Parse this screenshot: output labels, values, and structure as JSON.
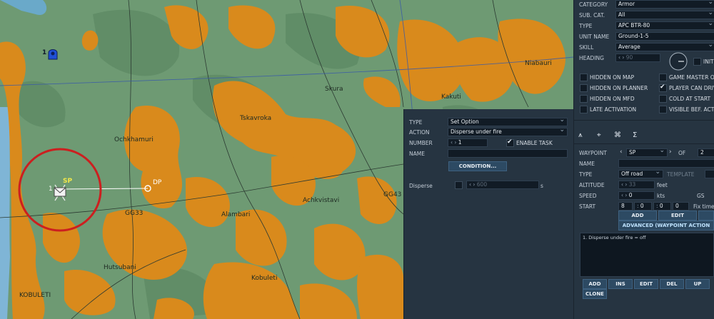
{
  "map": {
    "labels": {
      "skura": "Skura",
      "kakuti": "Kakuti",
      "niabauri": "Niabauri",
      "tskavroka": "Tskavroka",
      "ochkhamuri": "Ochkhamuri",
      "gg33": "GG33",
      "alambari": "Alambari",
      "achkvistavi": "Achkvistavi",
      "gg43": "GG43",
      "hutsubani": "Hutsubani",
      "kobuleti_town": "Kobuleti",
      "kobuleti_city": "KOBULETI"
    },
    "blue_unit_number": "1",
    "group_number": "1",
    "sp_label": "SP",
    "dp_label": "DP"
  },
  "task": {
    "type_label": "TYPE",
    "type_value": "Set Option",
    "action_label": "ACTION",
    "action_value": "Disperse under fire",
    "number_label": "NUMBER",
    "number_value": "1",
    "enable_task_label": "ENABLE TASK",
    "name_label": "NAME",
    "name_value": "",
    "condition_button": "CONDITION...",
    "disperse_label": "Disperse",
    "disperse_value": "600",
    "disperse_unit": "s"
  },
  "unit": {
    "category_label": "CATEGORY",
    "category_value": "Armor",
    "subcat_label": "SUB. CAT.",
    "subcat_value": "All",
    "type_label": "TYPE",
    "type_value": "APC BTR-80",
    "unit_name_label": "UNIT NAME",
    "unit_name_value": "Ground-1-5",
    "skill_label": "SKILL",
    "skill_value": "Average",
    "heading_label": "HEADING",
    "heading_value": "90",
    "init_label": "INIT",
    "checks": {
      "hidden_on_map": "HIDDEN ON MAP",
      "hidden_on_planner": "HIDDEN ON PLANNER",
      "hidden_on_mfd": "HIDDEN ON MFD",
      "late_activation": "LATE ACTIVATION",
      "game_master_only": "GAME MASTER ON",
      "player_can_drive": "PLAYER CAN DRIV",
      "cold_at_start": "COLD AT START",
      "visible_before_activation": "VISIBLE BEF. ACTI"
    }
  },
  "waypoint": {
    "waypoint_label": "WAYPOINT",
    "waypoint_value": "SP",
    "of_label": "OF",
    "of_value": "2",
    "name_label": "NAME",
    "type_label": "TYPE",
    "type_value": "Off road",
    "template_label": "TEMPLATE",
    "altitude_label": "ALTITUDE",
    "altitude_value": "33",
    "altitude_unit": "feet",
    "speed_label": "SPEED",
    "speed_value": "0",
    "speed_unit": "kts",
    "gs_label": "GS",
    "start_label": "START",
    "start_day": "8",
    "start_h": "0",
    "start_m": "0",
    "start_s": "0",
    "fix_time_label": "Fix time",
    "add_button": "ADD",
    "edit_button": "EDIT",
    "advanced_button": "ADVANCED (WAYPOINT ACTION",
    "action_list": [
      "1. Disperse under fire = off"
    ],
    "bottom_buttons": [
      "ADD",
      "INS",
      "EDIT",
      "DEL",
      "UP"
    ],
    "clone_button": "CLONE"
  },
  "colors": {
    "panel_bg": "#263441",
    "field_bg": "#111b25",
    "map_green": "#6e9a73",
    "urban_orange": "#d98a1c",
    "arrow_red": "#e0202a"
  }
}
